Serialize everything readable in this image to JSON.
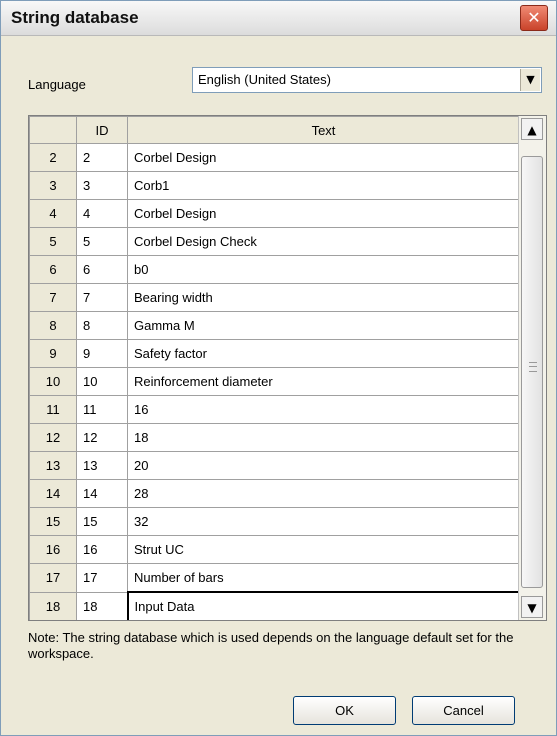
{
  "dialog": {
    "title": "String database",
    "close_glyph": "✕"
  },
  "language": {
    "label": "Language",
    "value": "English (United States)",
    "dropdown_icon": "chevron-down-icon"
  },
  "grid": {
    "headers": {
      "rownum": "",
      "id": "ID",
      "text": "Text"
    },
    "rows": [
      {
        "n": "2",
        "id": "2",
        "text": "Corbel Design"
      },
      {
        "n": "3",
        "id": "3",
        "text": "Corb1"
      },
      {
        "n": "4",
        "id": "4",
        "text": "Corbel Design"
      },
      {
        "n": "5",
        "id": "5",
        "text": "Corbel Design Check"
      },
      {
        "n": "6",
        "id": "6",
        "text": "b0"
      },
      {
        "n": "7",
        "id": "7",
        "text": "Bearing width"
      },
      {
        "n": "8",
        "id": "8",
        "text": "Gamma M"
      },
      {
        "n": "9",
        "id": "9",
        "text": "Safety factor"
      },
      {
        "n": "10",
        "id": "10",
        "text": "Reinforcement diameter"
      },
      {
        "n": "11",
        "id": "11",
        "text": "16"
      },
      {
        "n": "12",
        "id": "12",
        "text": "18"
      },
      {
        "n": "13",
        "id": "13",
        "text": "20"
      },
      {
        "n": "14",
        "id": "14",
        "text": "28"
      },
      {
        "n": "15",
        "id": "15",
        "text": "32"
      },
      {
        "n": "16",
        "id": "16",
        "text": "Strut UC"
      },
      {
        "n": "17",
        "id": "17",
        "text": "Number of bars"
      },
      {
        "n": "18",
        "id": "18",
        "text": "Input Data"
      }
    ]
  },
  "note": "Note: The string database which is used depends on the language default set for the workspace.",
  "buttons": {
    "ok": "OK",
    "cancel": "Cancel"
  }
}
